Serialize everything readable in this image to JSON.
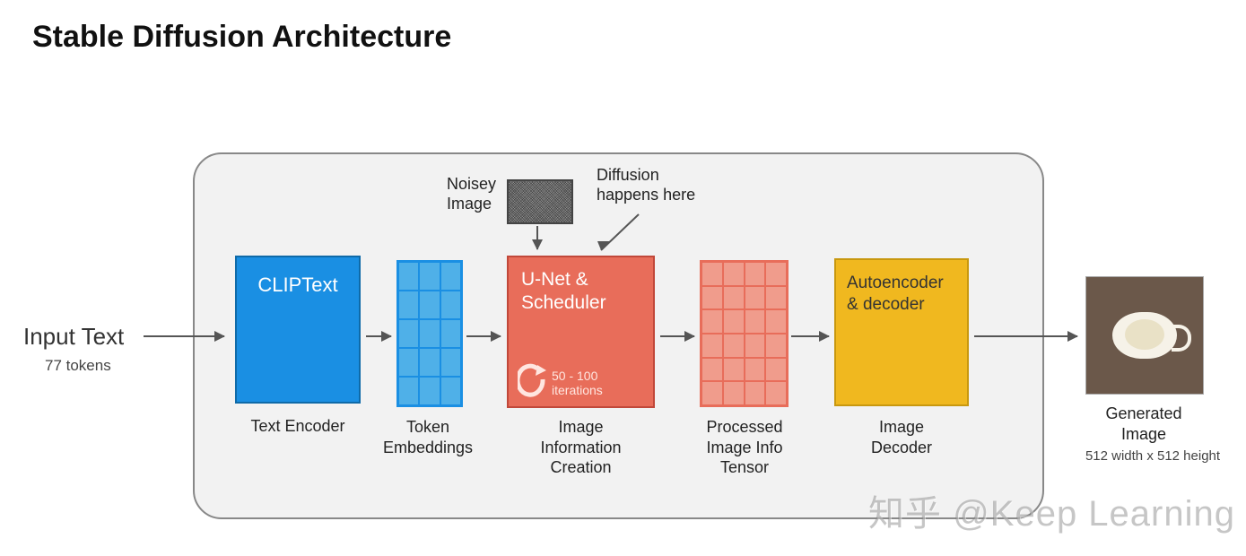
{
  "title": "Stable Diffusion Architecture",
  "input": {
    "label": "Input Text",
    "sub": "77 tokens"
  },
  "noisy": {
    "label": "Noisey\nImage"
  },
  "diffusion_note": "Diffusion\nhappens here",
  "stages": {
    "clip": {
      "box": "CLIPText",
      "caption": "Text Encoder"
    },
    "tokens": {
      "caption": "Token\nEmbeddings"
    },
    "unet": {
      "box": "U-Net &\nScheduler",
      "iterations": "50 - 100\niterations",
      "caption": "Image\nInformation\nCreation"
    },
    "proc": {
      "caption": "Processed\nImage Info\nTensor"
    },
    "decoder": {
      "box": "Autoencoder\n& decoder",
      "caption": "Image\nDecoder"
    }
  },
  "output": {
    "caption": "Generated\nImage",
    "sub": "512 width  x 512 height"
  },
  "watermark": {
    "zh": "知乎",
    "handle": "@Keep Learning"
  }
}
